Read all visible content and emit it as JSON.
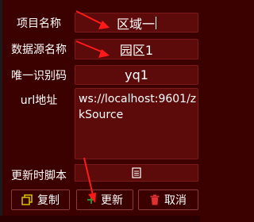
{
  "form": {
    "project_name_label": "项目名称",
    "project_name_value": "区域一",
    "datasource_label": "数据源名称",
    "datasource_value": "园区1",
    "uid_label": "唯一识别码",
    "uid_value": "yq1",
    "url_label": "url地址",
    "url_value": "ws://localhost:9601/zkSource",
    "script_label": "更新时脚本"
  },
  "buttons": {
    "copy_label": "复制",
    "update_label": "更新",
    "cancel_label": "取消"
  },
  "colors": {
    "background": "#3b0000",
    "field": "#5c0a0a",
    "annotation_red": "#ff1a1a",
    "copy_icon": "#d8c400",
    "update_icon": "#2f8a2f",
    "cancel_icon": "#e03030"
  },
  "icons": {
    "copy": "copy-icon",
    "update": "plus-icon",
    "cancel": "trash-icon",
    "script": "document-icon"
  }
}
